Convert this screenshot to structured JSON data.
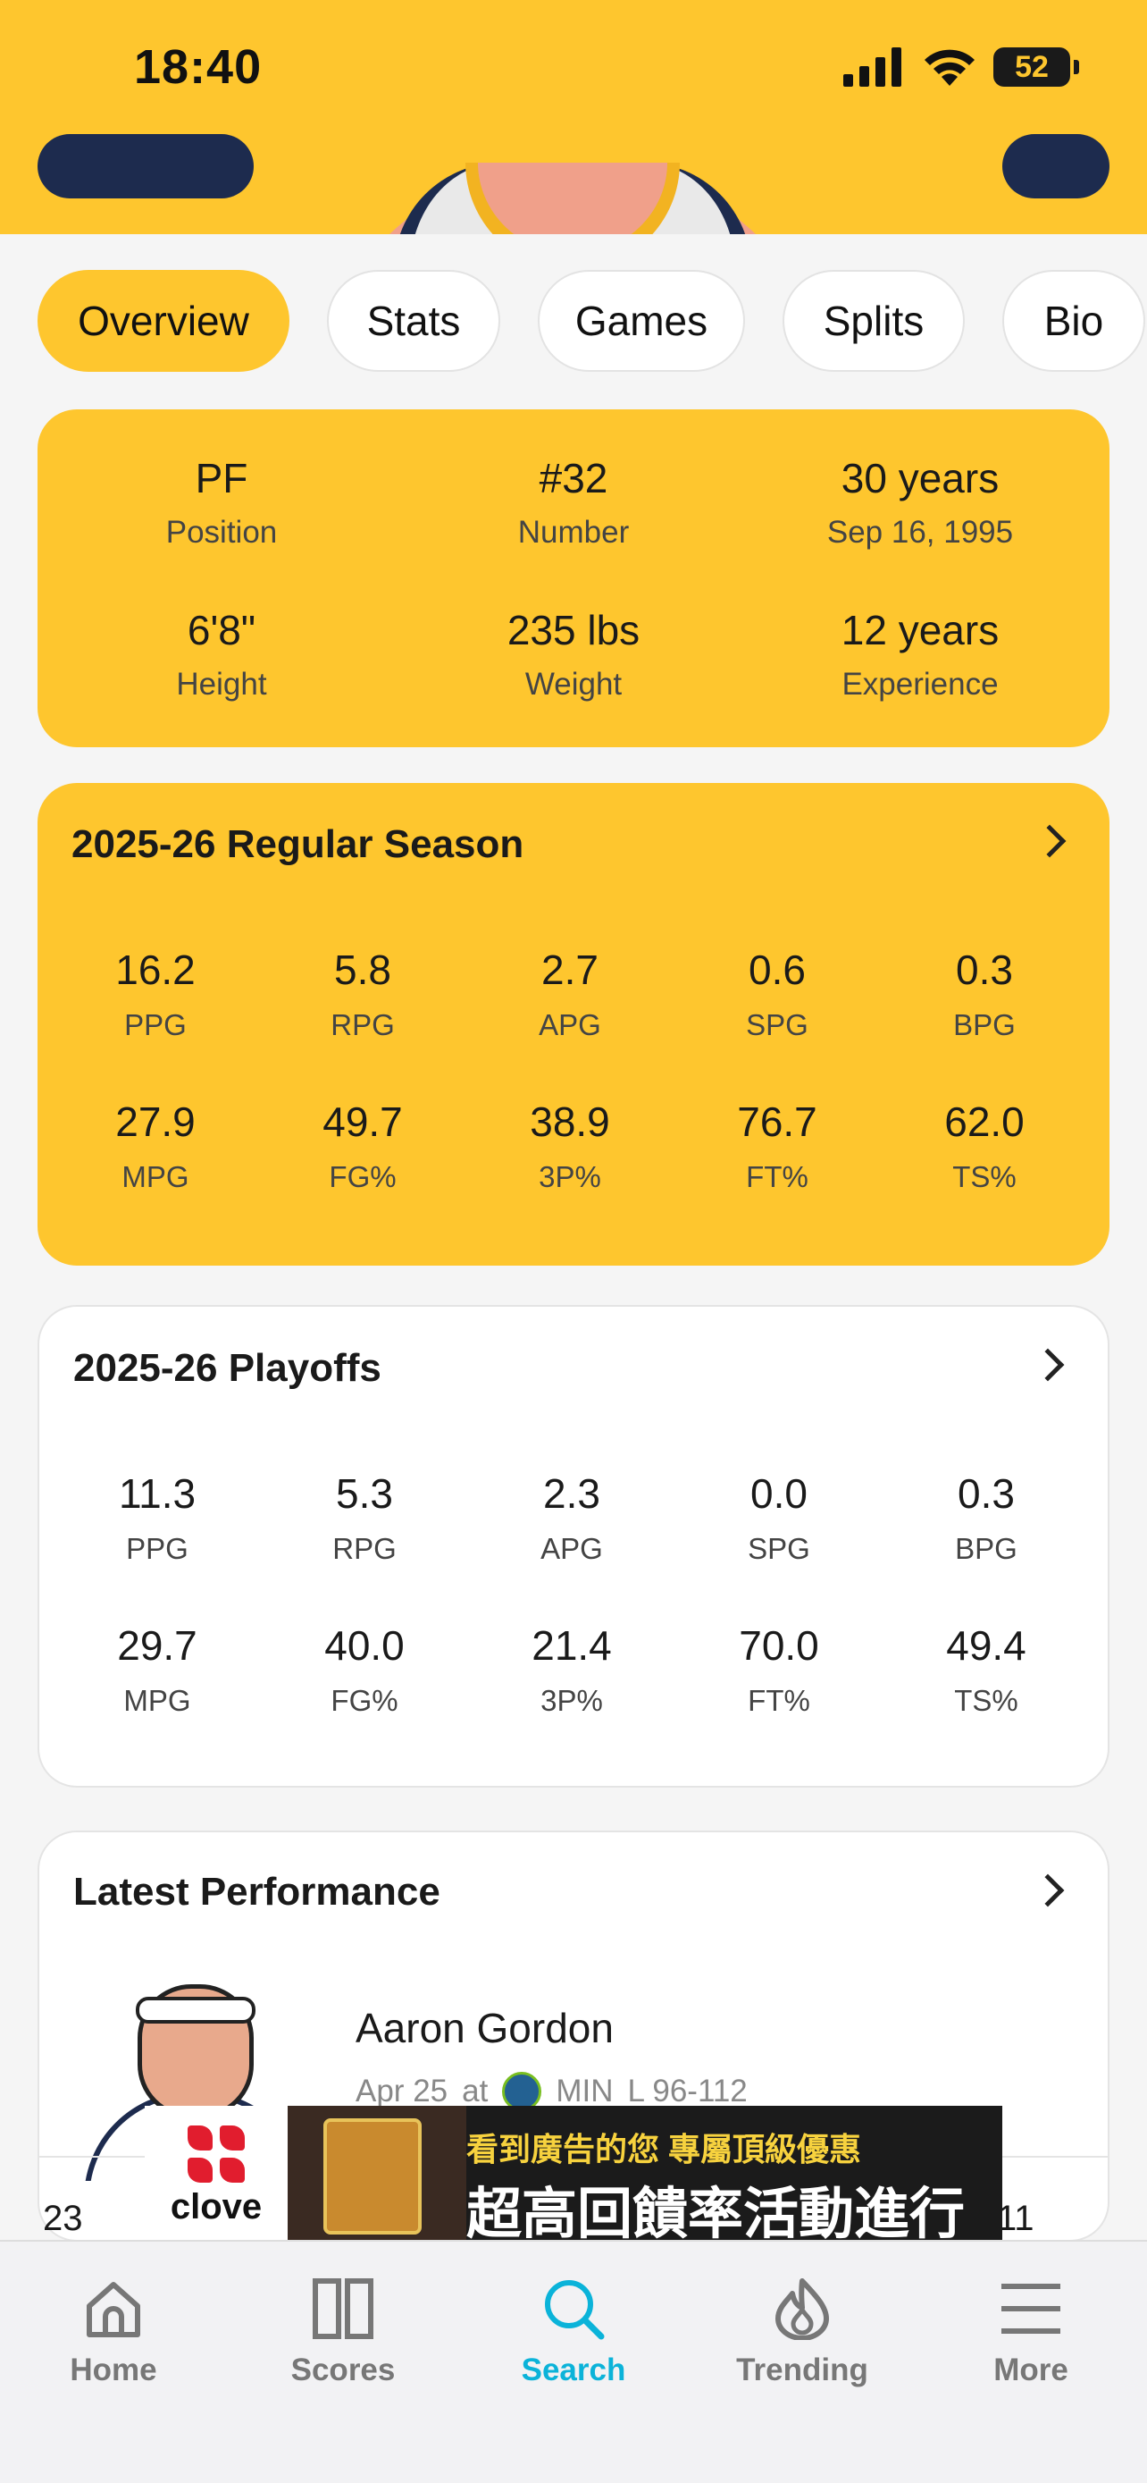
{
  "status_bar": {
    "time": "18:40",
    "battery": "52"
  },
  "tabs": [
    {
      "label": "Overview",
      "active": true
    },
    {
      "label": "Stats",
      "active": false
    },
    {
      "label": "Games",
      "active": false
    },
    {
      "label": "Splits",
      "active": false
    },
    {
      "label": "Bio",
      "active": false
    }
  ],
  "player_info": [
    {
      "value": "PF",
      "label": "Position"
    },
    {
      "value": "#32",
      "label": "Number"
    },
    {
      "value": "30 years",
      "label": "Sep 16, 1995"
    },
    {
      "value": "6'8\"",
      "label": "Height"
    },
    {
      "value": "235 lbs",
      "label": "Weight"
    },
    {
      "value": "12 years",
      "label": "Experience"
    }
  ],
  "regular_season": {
    "title": "2025-26 Regular Season",
    "stats": [
      {
        "value": "16.2",
        "label": "PPG"
      },
      {
        "value": "5.8",
        "label": "RPG"
      },
      {
        "value": "2.7",
        "label": "APG"
      },
      {
        "value": "0.6",
        "label": "SPG"
      },
      {
        "value": "0.3",
        "label": "BPG"
      },
      {
        "value": "27.9",
        "label": "MPG"
      },
      {
        "value": "49.7",
        "label": "FG%"
      },
      {
        "value": "38.9",
        "label": "3P%"
      },
      {
        "value": "76.7",
        "label": "FT%"
      },
      {
        "value": "62.0",
        "label": "TS%"
      }
    ]
  },
  "playoffs": {
    "title": "2025-26 Playoffs",
    "stats": [
      {
        "value": "11.3",
        "label": "PPG"
      },
      {
        "value": "5.3",
        "label": "RPG"
      },
      {
        "value": "2.3",
        "label": "APG"
      },
      {
        "value": "0.0",
        "label": "SPG"
      },
      {
        "value": "0.3",
        "label": "BPG"
      },
      {
        "value": "29.7",
        "label": "MPG"
      },
      {
        "value": "40.0",
        "label": "FG%"
      },
      {
        "value": "21.4",
        "label": "3P%"
      },
      {
        "value": "70.0",
        "label": "FT%"
      },
      {
        "value": "49.4",
        "label": "TS%"
      }
    ]
  },
  "latest_performance": {
    "title": "Latest Performance",
    "player_name": "Aaron Gordon",
    "date": "Apr 25",
    "location": "at",
    "opponent": "MIN",
    "result": "L 96-112",
    "left_value": "23",
    "right_value": "11"
  },
  "ad": {
    "brand": "clove",
    "line1": "看到廣告的您 專屬頂級優惠",
    "line2": "超高回饋率活動進行中!"
  },
  "bottom_nav": [
    {
      "label": "Home",
      "icon": "home-icon",
      "active": false
    },
    {
      "label": "Scores",
      "icon": "scores-icon",
      "active": false
    },
    {
      "label": "Search",
      "icon": "search-icon",
      "active": true
    },
    {
      "label": "Trending",
      "icon": "flame-icon",
      "active": false
    },
    {
      "label": "More",
      "icon": "menu-icon",
      "active": false
    }
  ],
  "colors": {
    "accent": "#FEC62E",
    "active_nav": "#0BB3D9",
    "team_navy": "#1D2B4E"
  }
}
